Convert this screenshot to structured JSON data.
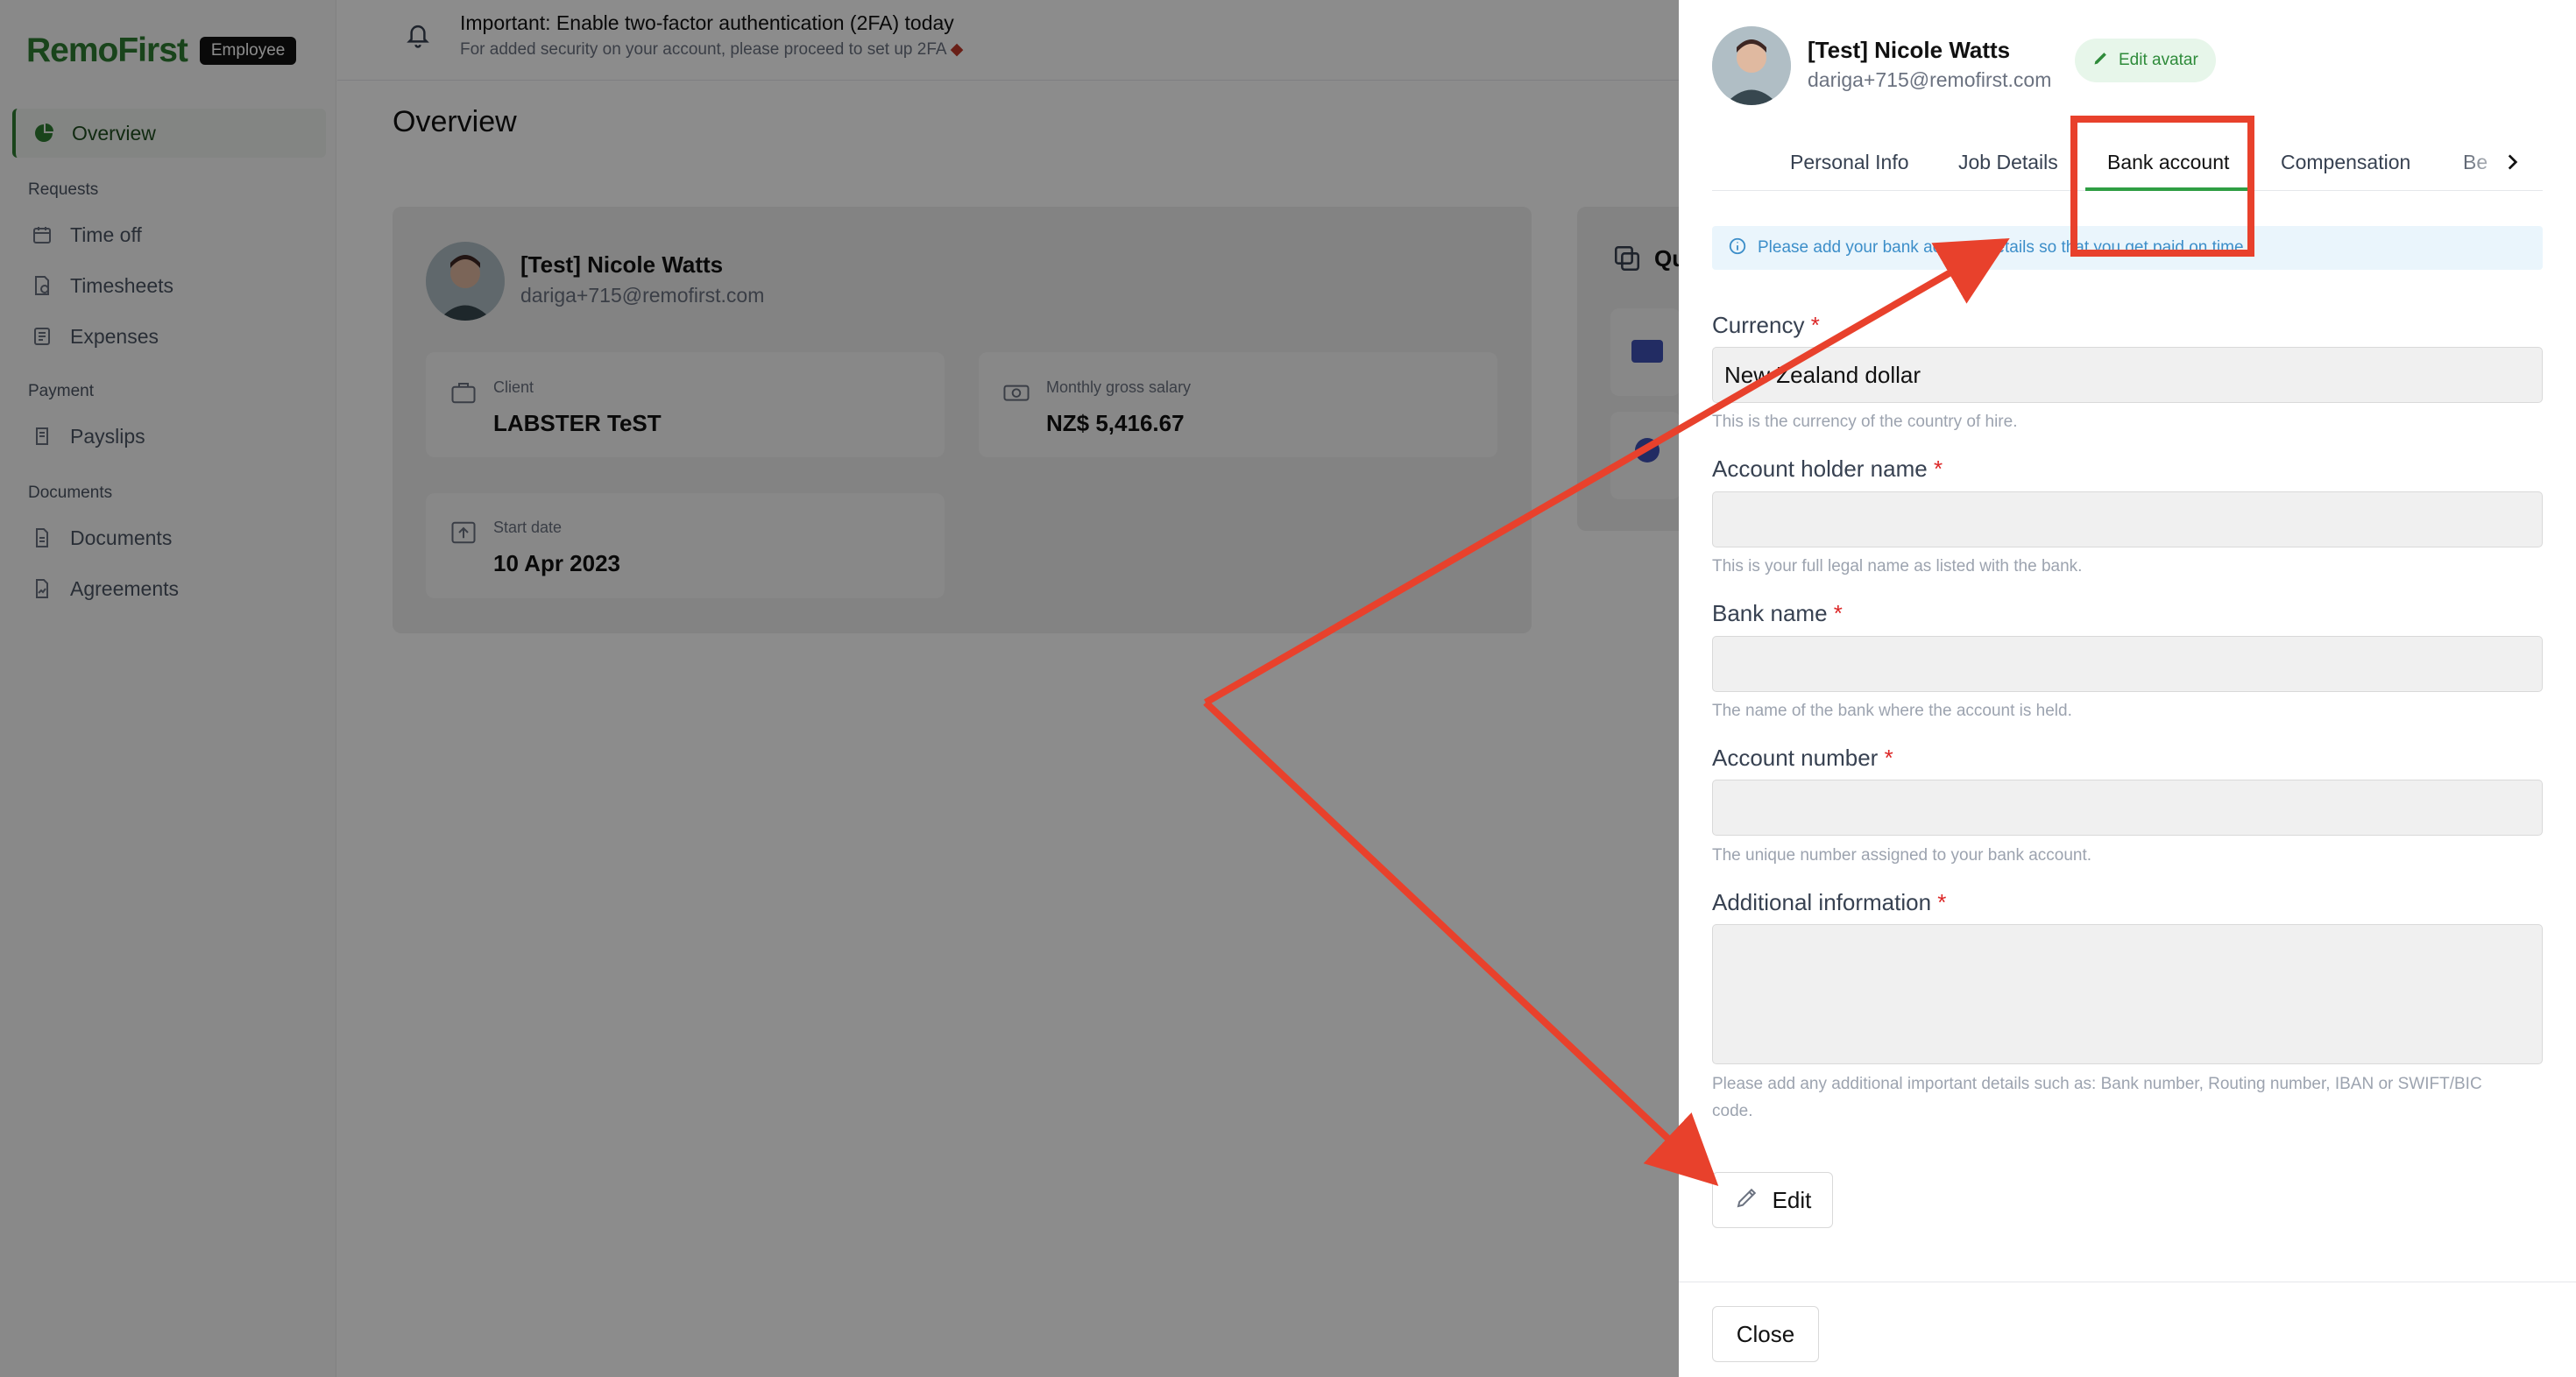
{
  "sidebar": {
    "logo": "RemoFirst",
    "badge": "Employee",
    "overview": "Overview",
    "requests_heading": "Requests",
    "time_off": "Time off",
    "timesheets": "Timesheets",
    "expenses": "Expenses",
    "payment_heading": "Payment",
    "payslips": "Payslips",
    "documents_heading": "Documents",
    "documents": "Documents",
    "agreements": "Agreements"
  },
  "banner": {
    "title": "Important: Enable two-factor authentication (2FA) today",
    "subtitle": "For added security on your account, please proceed to set up 2FA"
  },
  "main": {
    "page_title": "Overview",
    "profile": {
      "name": "[Test] Nicole Watts",
      "email": "dariga+715@remofirst.com",
      "client_label": "Client",
      "client_value": "LABSTER TeST",
      "salary_label": "Monthly gross salary",
      "salary_value": "NZ$ 5,416.67",
      "start_label": "Start date",
      "start_value": "10 Apr 2023"
    },
    "quick_title": "Qu"
  },
  "drawer": {
    "name": "[Test] Nicole Watts",
    "email": "dariga+715@remofirst.com",
    "edit_avatar": "Edit avatar",
    "tabs": [
      "Personal Info",
      "Job Details",
      "Bank account",
      "Compensation",
      "Be"
    ],
    "active_tab": "Bank account",
    "info_message": "Please add your bank account details so that you get paid on time.",
    "fields": {
      "currency": {
        "label": "Currency",
        "value": "New Zealand dollar",
        "help": "This is the currency of the country of hire."
      },
      "holder": {
        "label": "Account holder name",
        "value": "",
        "help": "This is your full legal name as listed with the bank."
      },
      "bank": {
        "label": "Bank name",
        "value": "",
        "help": "The name of the bank where the account is held."
      },
      "number": {
        "label": "Account number",
        "value": "",
        "help": "The unique number assigned to your bank account."
      },
      "additional": {
        "label": "Additional information",
        "value": "",
        "help": "Please add any additional important details such as: Bank number, Routing number, IBAN or SWIFT/BIC code."
      }
    },
    "required_mark": "*",
    "edit_button": "Edit",
    "close_button": "Close"
  },
  "colors": {
    "brand_green": "#2f7d32",
    "active_tab_underline": "#2f9e44",
    "annotation_red": "#e8412c",
    "info_blue": "#3c8ec9",
    "required_red": "#dc2626"
  }
}
